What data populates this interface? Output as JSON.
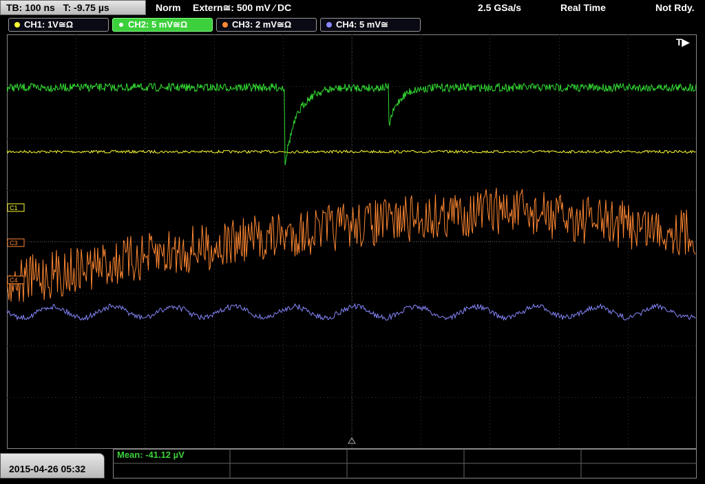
{
  "header": {
    "timebase_label": "TB: 100 ns",
    "trigger_time_label": "T: -9.75 µs",
    "trigger_mode": "Norm",
    "trigger_source": "Extern≅: 500 mV ⁄ DC",
    "sample_rate": "2.5 GSa/s",
    "acq_mode": "Real Time",
    "status": "Not Rdy."
  },
  "channels": [
    {
      "label": "CH1: 1V≅Ω",
      "color": "#ffff33"
    },
    {
      "label": "CH2: 5 mV≅Ω",
      "color": "#33dd33"
    },
    {
      "label": "CH3: 2 mV≅Ω",
      "color": "#ff8833"
    },
    {
      "label": "CH4: 5 mV≅",
      "color": "#8888ff"
    }
  ],
  "markers": {
    "trigger": "T▶",
    "c1": "C1",
    "c3": "C3",
    "c4": "C4"
  },
  "footer": {
    "datetime": "2015-04-26 05:32",
    "measurement": "Mean: -41.12 µV"
  },
  "traces": {
    "ch1_level": 0.283,
    "ch2_level": 0.128,
    "ch3_level_start": 0.6,
    "ch3_level_end": 0.45,
    "ch4_level": 0.67
  }
}
